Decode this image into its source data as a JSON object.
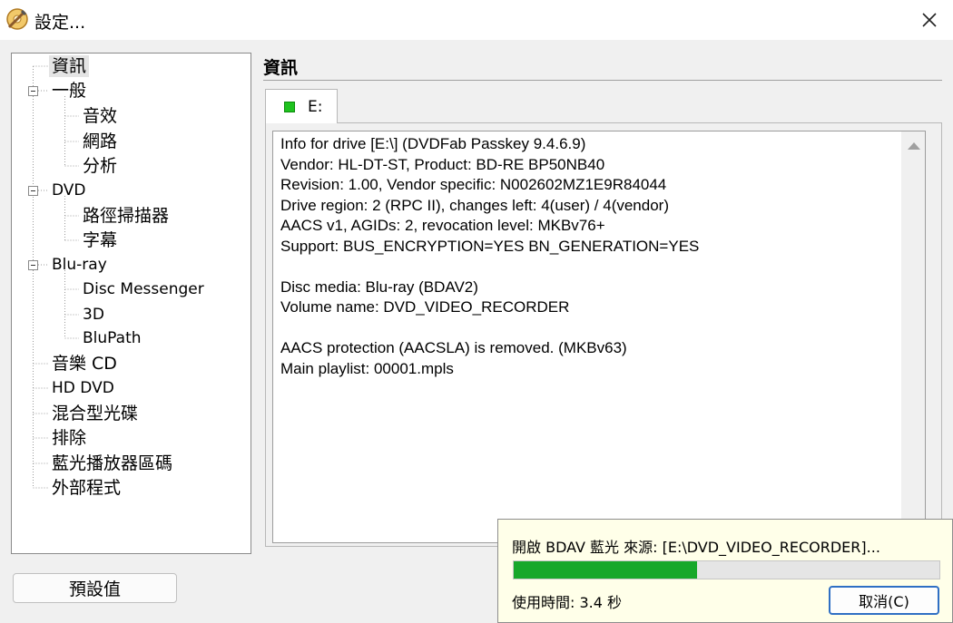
{
  "window": {
    "title": "設定...",
    "close_glyph": "✕",
    "icon": "app-icon"
  },
  "tree": {
    "items": [
      {
        "label": "資訊",
        "selected": true
      },
      {
        "label": "一般",
        "expanded": true
      },
      {
        "label": "音效"
      },
      {
        "label": "網路"
      },
      {
        "label": "分析"
      },
      {
        "label": "DVD",
        "expanded": true
      },
      {
        "label": "路徑掃描器"
      },
      {
        "label": "字幕"
      },
      {
        "label": "Blu-ray",
        "expanded": true
      },
      {
        "label": "Disc Messenger"
      },
      {
        "label": "3D"
      },
      {
        "label": "BluPath"
      },
      {
        "label": "音樂 CD"
      },
      {
        "label": "HD DVD"
      },
      {
        "label": "混合型光碟"
      },
      {
        "label": "排除"
      },
      {
        "label": "藍光播放器區碼"
      },
      {
        "label": "外部程式"
      }
    ]
  },
  "section": {
    "title": "資訊"
  },
  "tab": {
    "label": "E:",
    "status_color": "#1ec21e"
  },
  "info": {
    "text": "Info for drive [E:\\] (DVDFab Passkey 9.4.6.9)\nVendor: HL-DT-ST, Product: BD-RE BP50NB40\nRevision: 1.00, Vendor specific: N002602MZ1E9R84044\nDrive region: 2 (RPC II), changes left: 4(user) / 4(vendor)\nAACS v1, AGIDs: 2, revocation level: MKBv76+\nSupport: BUS_ENCRYPTION=YES BN_GENERATION=YES\n\nDisc media: Blu-ray (BDAV2)\nVolume name: DVD_VIDEO_RECORDER\n\nAACS protection (AACSLA) is removed. (MKBv63)\nMain playlist: 00001.mpls"
  },
  "buttons": {
    "defaults": "預設值"
  },
  "progress_popup": {
    "message": "開啟 BDAV 藍光 來源: [E:\\DVD_VIDEO_RECORDER]...",
    "progress_fraction": 0.43,
    "progress_color": "#17a82a",
    "elapsed": "使用時間: 3.4 秒",
    "cancel_label": "取消(C)"
  }
}
